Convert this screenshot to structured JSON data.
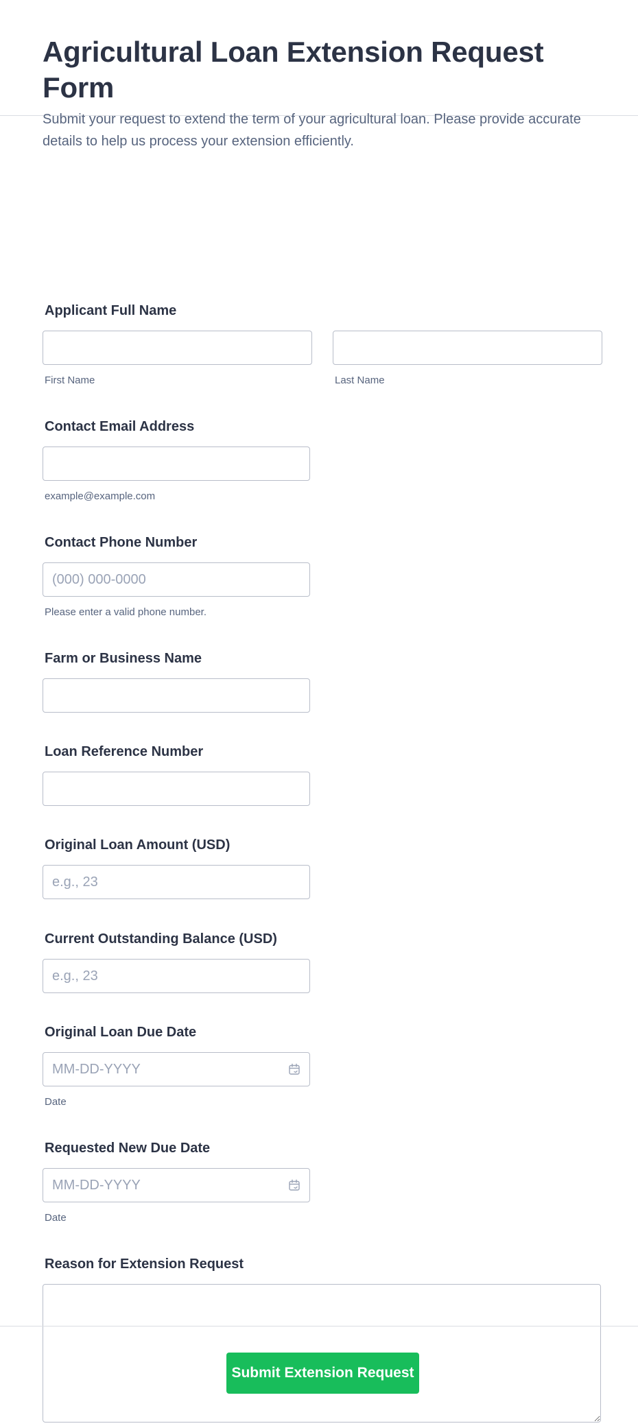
{
  "form": {
    "title": "Agricultural Loan Extension Request Form",
    "description": "Submit your request to extend the term of your agricultural loan. Please provide accurate details to help us process your extension efficiently."
  },
  "fields": {
    "full_name": {
      "label": "Applicant Full Name",
      "first_sublabel": "First Name",
      "last_sublabel": "Last Name",
      "first_value": "",
      "last_value": ""
    },
    "email": {
      "label": "Contact Email Address",
      "sublabel": "example@example.com",
      "value": ""
    },
    "phone": {
      "label": "Contact Phone Number",
      "placeholder": "(000) 000-0000",
      "sublabel": "Please enter a valid phone number.",
      "value": ""
    },
    "farm_name": {
      "label": "Farm or Business Name",
      "value": ""
    },
    "loan_ref": {
      "label": "Loan Reference Number",
      "value": ""
    },
    "original_amount": {
      "label": "Original Loan Amount (USD)",
      "placeholder": "e.g., 23",
      "value": ""
    },
    "outstanding_balance": {
      "label": "Current Outstanding Balance (USD)",
      "placeholder": "e.g., 23",
      "value": ""
    },
    "original_due_date": {
      "label": "Original Loan Due Date",
      "placeholder": "MM-DD-YYYY",
      "sublabel": "Date",
      "icon": "calendar-icon",
      "value": ""
    },
    "new_due_date": {
      "label": "Requested New Due Date",
      "placeholder": "MM-DD-YYYY",
      "sublabel": "Date",
      "icon": "calendar-icon",
      "value": ""
    },
    "reason": {
      "label": "Reason for Extension Request",
      "value": ""
    }
  },
  "actions": {
    "submit_label": "Submit Extension Request"
  },
  "colors": {
    "submit_bg": "#18bd5b",
    "text": "#2c3345",
    "muted": "#57647e",
    "border": "#b8bdc9",
    "placeholder": "#9aa3b6"
  }
}
